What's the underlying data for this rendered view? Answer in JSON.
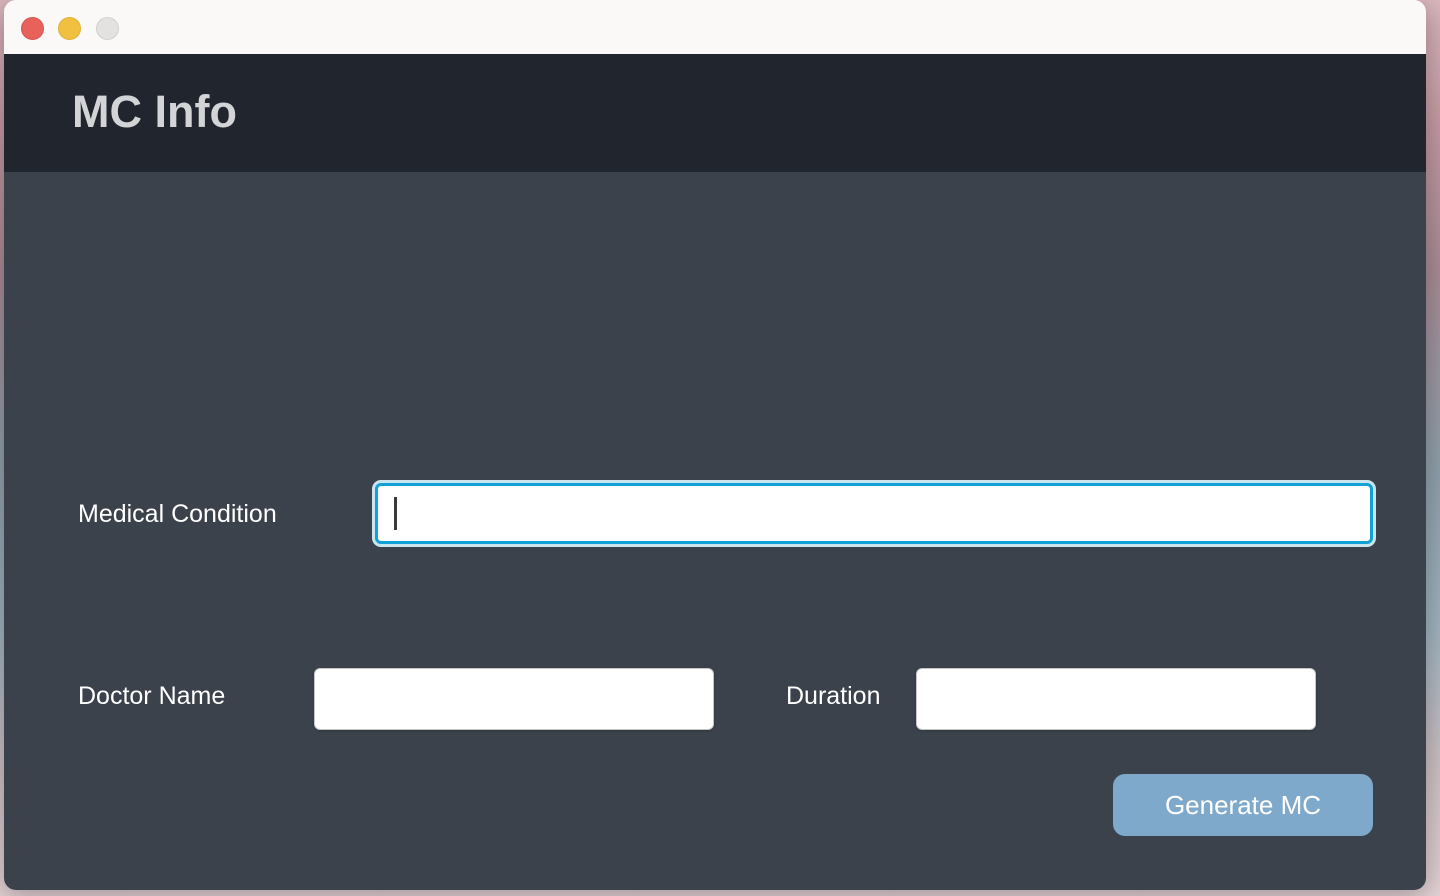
{
  "window": {
    "traffic_lights": [
      {
        "name": "close",
        "color": "#e8615a"
      },
      {
        "name": "minimize",
        "color": "#f2c040"
      },
      {
        "name": "zoom",
        "color": "#e3e2e0"
      }
    ]
  },
  "header": {
    "title": "MC Info",
    "background": "#21262e",
    "title_color": "#d2d4d6"
  },
  "body": {
    "background": "#3b424c"
  },
  "form": {
    "fields": [
      {
        "id": "medical-condition",
        "label": "Medical Condition",
        "value": "",
        "placeholder": "",
        "focused": true,
        "focus_color": "#12a0d8"
      },
      {
        "id": "doctor-name",
        "label": "Doctor Name",
        "value": "",
        "placeholder": "",
        "focused": false
      },
      {
        "id": "duration",
        "label": "Duration",
        "value": "",
        "placeholder": "",
        "focused": false
      }
    ],
    "submit": {
      "label": "Generate MC",
      "background": "#7ea9cb",
      "text_color": "#ffffff"
    }
  }
}
